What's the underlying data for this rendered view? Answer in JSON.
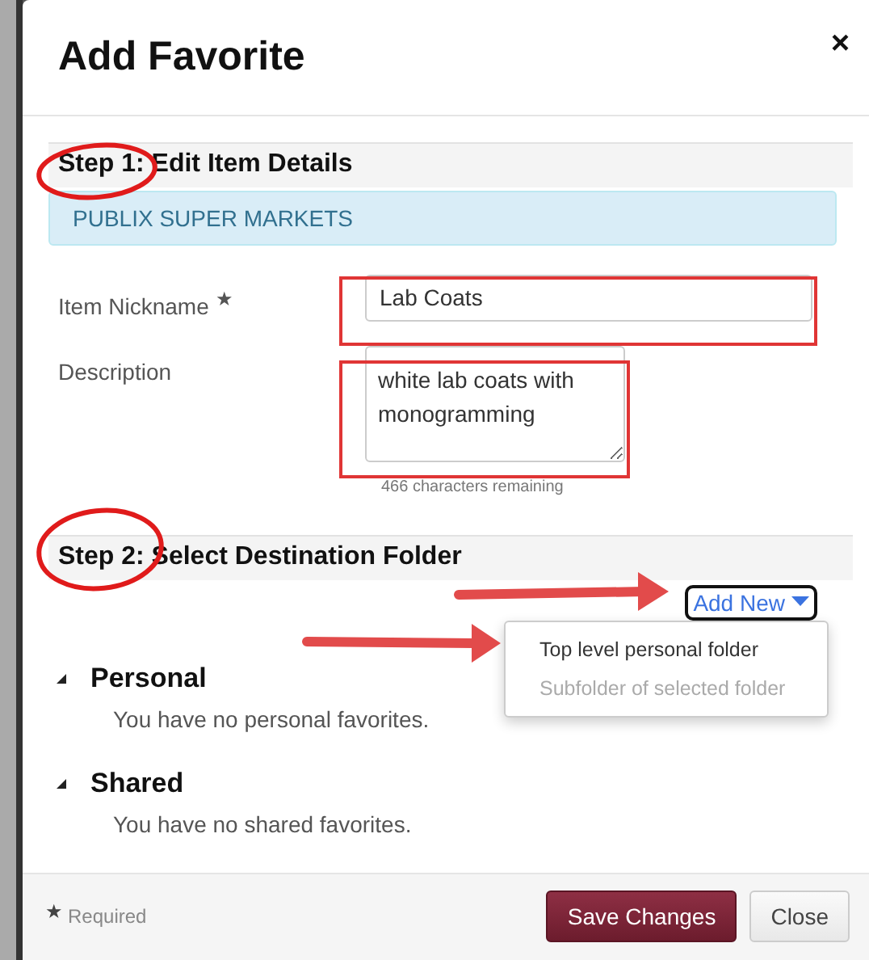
{
  "dialog": {
    "title": "Add Favorite",
    "close": "×"
  },
  "step1": {
    "title": "Step 1: Edit Item Details",
    "vendor": "PUBLIX SUPER MARKETS",
    "nickname": {
      "label": "Item Nickname",
      "required_mark": "★",
      "value": "Lab Coats"
    },
    "description": {
      "label": "Description",
      "value": "white lab coats with monogramming",
      "hint": "466 characters remaining"
    }
  },
  "step2": {
    "title": "Step 2: Select Destination Folder",
    "add_new": {
      "label": "Add New",
      "open": true,
      "menu": [
        {
          "label": "Top level personal folder",
          "disabled": false
        },
        {
          "label": "Subfolder of selected folder",
          "disabled": true
        }
      ]
    },
    "groups": [
      {
        "name": "Personal",
        "expanded": true,
        "message": "You have no personal favorites."
      },
      {
        "name": "Shared",
        "expanded": true,
        "message": "You have no shared favorites."
      }
    ]
  },
  "footer": {
    "required_mark": "★",
    "required": "Required",
    "buttons": [
      {
        "label": "Save Changes",
        "kind": "primary"
      },
      {
        "label": "Close",
        "kind": "default"
      }
    ]
  }
}
